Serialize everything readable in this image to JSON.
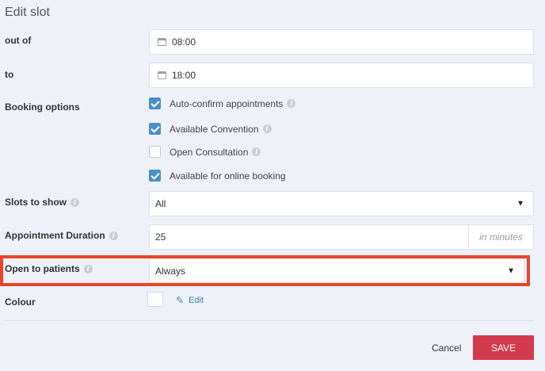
{
  "title": "Edit slot",
  "fields": {
    "out_of": {
      "label": "out of",
      "value": "08:00",
      "icon": "calendar-icon"
    },
    "to": {
      "label": "to",
      "value": "18:00",
      "icon": "calendar-icon"
    }
  },
  "booking_options": {
    "label": "Booking options",
    "items": [
      {
        "label": "Auto-confirm appointments",
        "checked": true
      },
      {
        "label": "Available Convention",
        "checked": true
      },
      {
        "label": "Open Consultation",
        "checked": false
      },
      {
        "label": "Available for online booking",
        "checked": true
      }
    ]
  },
  "slots_to_show": {
    "label": "Slots to show",
    "value": "All"
  },
  "appointment_duration": {
    "label": "Appointment Duration",
    "value": "25",
    "suffix": "in minutes"
  },
  "open_to_patients": {
    "label": "Open to patients",
    "value": "Always"
  },
  "colour": {
    "label": "Colour",
    "edit_label": "Edit",
    "swatch": "#ffffff"
  },
  "actions": {
    "cancel": "Cancel",
    "save": "SAVE"
  },
  "colors": {
    "highlight": "#e8452c",
    "save_bg": "#d43a4f",
    "checkbox_on": "#4a90c8"
  }
}
